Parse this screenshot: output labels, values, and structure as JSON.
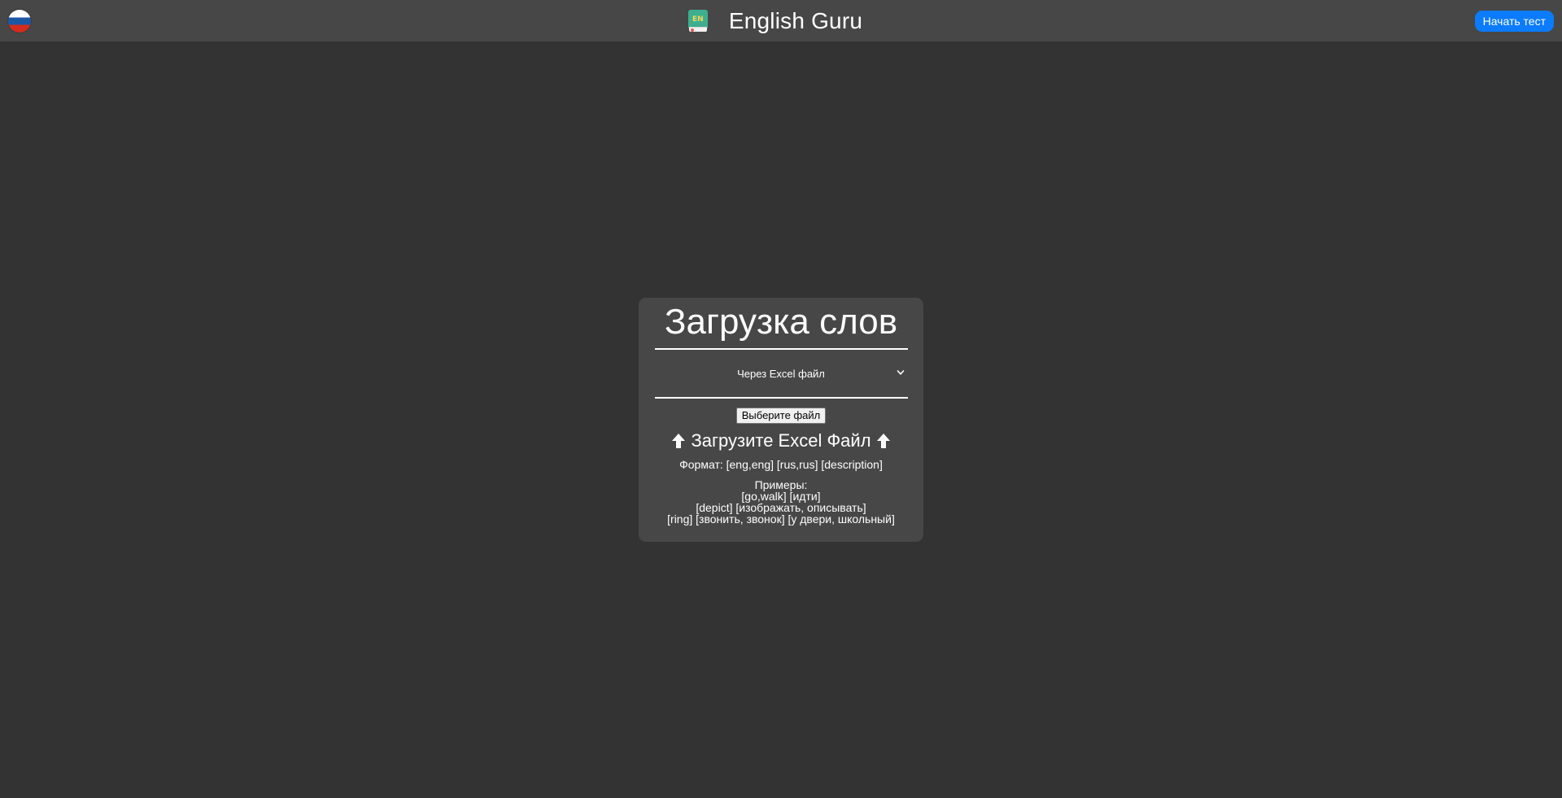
{
  "header": {
    "language_flag_icon": "russia-flag-icon",
    "logo_icon": "green-book-en-icon",
    "logo_badge": "EN",
    "title": "English Guru",
    "start_test_label": "Начать тест",
    "colors": {
      "bar": "#474747",
      "accent": "#0b7bff"
    }
  },
  "upload_card": {
    "title": "Загрузка слов",
    "method_select": {
      "selected": "Через Excel файл",
      "icon": "chevron-down-icon"
    },
    "file_button_label": "Выберите файл",
    "upload_heading": {
      "icon_left": "up-arrow-icon",
      "text": "Загрузите Excel Файл",
      "icon_right": "up-arrow-icon"
    },
    "format_line": "Формат: [eng,eng] [rus,rus] [description]",
    "examples": {
      "label": "Примеры:",
      "lines": [
        "[go,walk] [идти]",
        "[depict] [изображать, описывать]",
        "[ring] [звонить, звонок] [у двери, школьный]"
      ]
    }
  },
  "colors": {
    "background": "#333333",
    "card": "#474747",
    "text": "#ffffff"
  }
}
